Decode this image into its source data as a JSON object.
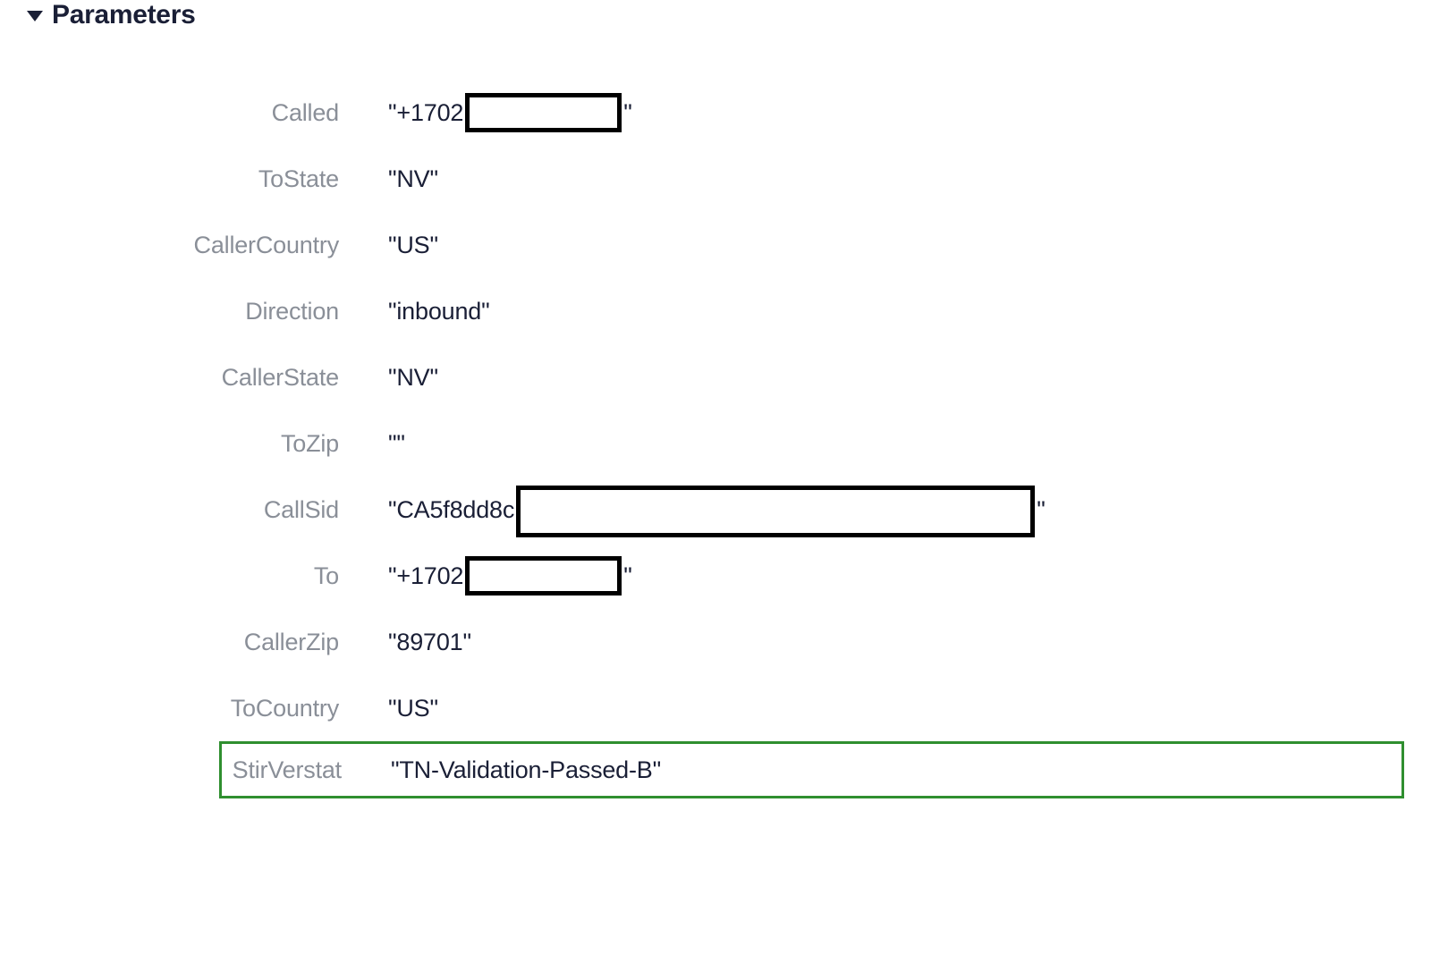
{
  "section": {
    "title": "Parameters"
  },
  "params": {
    "called": {
      "label": "Called",
      "prefix": "\"+1702",
      "suffix": "\"",
      "redact": "small"
    },
    "toState": {
      "label": "ToState",
      "value": "\"NV\""
    },
    "callerCountry": {
      "label": "CallerCountry",
      "value": "\"US\""
    },
    "direction": {
      "label": "Direction",
      "value": "\"inbound\""
    },
    "callerState": {
      "label": "CallerState",
      "value": "\"NV\""
    },
    "toZip": {
      "label": "ToZip",
      "value": "\"\""
    },
    "callSid": {
      "label": "CallSid",
      "prefix": "\"CA5f8dd8c",
      "suffix": "\"",
      "redact": "large"
    },
    "to": {
      "label": "To",
      "prefix": "\"+1702",
      "suffix": "\"",
      "redact": "small"
    },
    "callerZip": {
      "label": "CallerZip",
      "value": "\"89701\""
    },
    "toCountry": {
      "label": "ToCountry",
      "value": "\"US\""
    },
    "stirVerstat": {
      "label": "StirVerstat",
      "value": "\"TN-Validation-Passed-B\""
    }
  }
}
